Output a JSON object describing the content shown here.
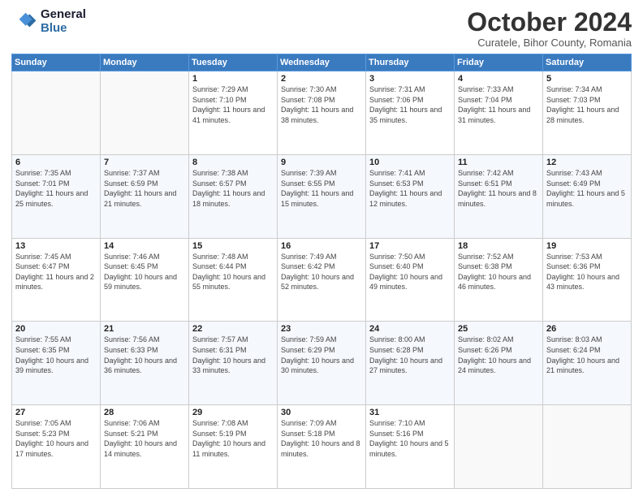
{
  "header": {
    "logo_line1": "General",
    "logo_line2": "Blue",
    "month": "October 2024",
    "location": "Curatele, Bihor County, Romania"
  },
  "days_of_week": [
    "Sunday",
    "Monday",
    "Tuesday",
    "Wednesday",
    "Thursday",
    "Friday",
    "Saturday"
  ],
  "weeks": [
    [
      {
        "day": "",
        "info": ""
      },
      {
        "day": "",
        "info": ""
      },
      {
        "day": "1",
        "info": "Sunrise: 7:29 AM\nSunset: 7:10 PM\nDaylight: 11 hours and 41 minutes."
      },
      {
        "day": "2",
        "info": "Sunrise: 7:30 AM\nSunset: 7:08 PM\nDaylight: 11 hours and 38 minutes."
      },
      {
        "day": "3",
        "info": "Sunrise: 7:31 AM\nSunset: 7:06 PM\nDaylight: 11 hours and 35 minutes."
      },
      {
        "day": "4",
        "info": "Sunrise: 7:33 AM\nSunset: 7:04 PM\nDaylight: 11 hours and 31 minutes."
      },
      {
        "day": "5",
        "info": "Sunrise: 7:34 AM\nSunset: 7:03 PM\nDaylight: 11 hours and 28 minutes."
      }
    ],
    [
      {
        "day": "6",
        "info": "Sunrise: 7:35 AM\nSunset: 7:01 PM\nDaylight: 11 hours and 25 minutes."
      },
      {
        "day": "7",
        "info": "Sunrise: 7:37 AM\nSunset: 6:59 PM\nDaylight: 11 hours and 21 minutes."
      },
      {
        "day": "8",
        "info": "Sunrise: 7:38 AM\nSunset: 6:57 PM\nDaylight: 11 hours and 18 minutes."
      },
      {
        "day": "9",
        "info": "Sunrise: 7:39 AM\nSunset: 6:55 PM\nDaylight: 11 hours and 15 minutes."
      },
      {
        "day": "10",
        "info": "Sunrise: 7:41 AM\nSunset: 6:53 PM\nDaylight: 11 hours and 12 minutes."
      },
      {
        "day": "11",
        "info": "Sunrise: 7:42 AM\nSunset: 6:51 PM\nDaylight: 11 hours and 8 minutes."
      },
      {
        "day": "12",
        "info": "Sunrise: 7:43 AM\nSunset: 6:49 PM\nDaylight: 11 hours and 5 minutes."
      }
    ],
    [
      {
        "day": "13",
        "info": "Sunrise: 7:45 AM\nSunset: 6:47 PM\nDaylight: 11 hours and 2 minutes."
      },
      {
        "day": "14",
        "info": "Sunrise: 7:46 AM\nSunset: 6:45 PM\nDaylight: 10 hours and 59 minutes."
      },
      {
        "day": "15",
        "info": "Sunrise: 7:48 AM\nSunset: 6:44 PM\nDaylight: 10 hours and 55 minutes."
      },
      {
        "day": "16",
        "info": "Sunrise: 7:49 AM\nSunset: 6:42 PM\nDaylight: 10 hours and 52 minutes."
      },
      {
        "day": "17",
        "info": "Sunrise: 7:50 AM\nSunset: 6:40 PM\nDaylight: 10 hours and 49 minutes."
      },
      {
        "day": "18",
        "info": "Sunrise: 7:52 AM\nSunset: 6:38 PM\nDaylight: 10 hours and 46 minutes."
      },
      {
        "day": "19",
        "info": "Sunrise: 7:53 AM\nSunset: 6:36 PM\nDaylight: 10 hours and 43 minutes."
      }
    ],
    [
      {
        "day": "20",
        "info": "Sunrise: 7:55 AM\nSunset: 6:35 PM\nDaylight: 10 hours and 39 minutes."
      },
      {
        "day": "21",
        "info": "Sunrise: 7:56 AM\nSunset: 6:33 PM\nDaylight: 10 hours and 36 minutes."
      },
      {
        "day": "22",
        "info": "Sunrise: 7:57 AM\nSunset: 6:31 PM\nDaylight: 10 hours and 33 minutes."
      },
      {
        "day": "23",
        "info": "Sunrise: 7:59 AM\nSunset: 6:29 PM\nDaylight: 10 hours and 30 minutes."
      },
      {
        "day": "24",
        "info": "Sunrise: 8:00 AM\nSunset: 6:28 PM\nDaylight: 10 hours and 27 minutes."
      },
      {
        "day": "25",
        "info": "Sunrise: 8:02 AM\nSunset: 6:26 PM\nDaylight: 10 hours and 24 minutes."
      },
      {
        "day": "26",
        "info": "Sunrise: 8:03 AM\nSunset: 6:24 PM\nDaylight: 10 hours and 21 minutes."
      }
    ],
    [
      {
        "day": "27",
        "info": "Sunrise: 7:05 AM\nSunset: 5:23 PM\nDaylight: 10 hours and 17 minutes."
      },
      {
        "day": "28",
        "info": "Sunrise: 7:06 AM\nSunset: 5:21 PM\nDaylight: 10 hours and 14 minutes."
      },
      {
        "day": "29",
        "info": "Sunrise: 7:08 AM\nSunset: 5:19 PM\nDaylight: 10 hours and 11 minutes."
      },
      {
        "day": "30",
        "info": "Sunrise: 7:09 AM\nSunset: 5:18 PM\nDaylight: 10 hours and 8 minutes."
      },
      {
        "day": "31",
        "info": "Sunrise: 7:10 AM\nSunset: 5:16 PM\nDaylight: 10 hours and 5 minutes."
      },
      {
        "day": "",
        "info": ""
      },
      {
        "day": "",
        "info": ""
      }
    ]
  ]
}
